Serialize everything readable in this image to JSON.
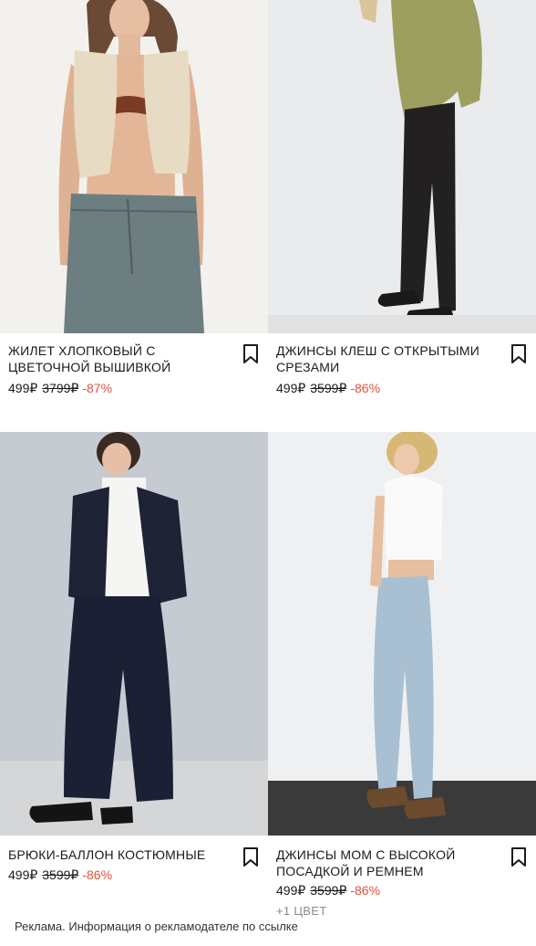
{
  "products": [
    {
      "title": "ЖИЛЕТ ХЛОПКОВЫЙ С ЦВЕТОЧНОЙ ВЫШИВКОЙ",
      "price": "499₽",
      "old_price": "3799₽",
      "discount": "-87%",
      "bookmark_icon": "bookmark-icon"
    },
    {
      "title": "ДЖИНСЫ КЛЕШ С ОТКРЫТЫМИ СРЕЗАМИ",
      "price": "499₽",
      "old_price": "3599₽",
      "discount": "-86%",
      "bookmark_icon": "bookmark-icon"
    },
    {
      "title": "БРЮКИ-БАЛЛОН КОСТЮМНЫЕ",
      "price": "499₽",
      "old_price": "3599₽",
      "discount": "-86%",
      "bookmark_icon": "bookmark-icon"
    },
    {
      "title": "ДЖИНСЫ МОМ С ВЫСОКОЙ ПОСАДКОЙ И РЕМНЕМ",
      "price": "499₽",
      "old_price": "3599₽",
      "discount": "-86%",
      "extra": "+1 ЦВЕТ",
      "bookmark_icon": "bookmark-icon"
    }
  ],
  "footer": {
    "ad_text": "Реклама. Информация о рекламодателе по ссылке"
  },
  "colors": {
    "discount": "#e4513a",
    "text": "#1a1a1a",
    "muted": "#8a8a8a"
  }
}
